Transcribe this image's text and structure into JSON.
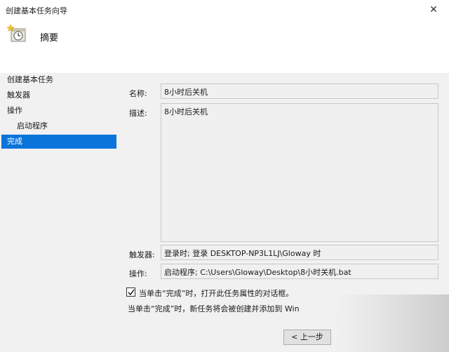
{
  "window": {
    "title": "创建基本任务向导",
    "close_glyph": "✕"
  },
  "header": {
    "heading": "摘要",
    "icon": "task-clock-icon"
  },
  "sidebar": {
    "items": [
      {
        "label": "创建基本任务"
      },
      {
        "label": "触发器"
      },
      {
        "label": "操作"
      },
      {
        "label": "启动程序"
      },
      {
        "label": "完成"
      }
    ]
  },
  "summary": {
    "name_label": "名称:",
    "name_value": "8小时后关机",
    "desc_label": "描述:",
    "desc_value": "8小时后关机",
    "trigger_label": "触发器:",
    "trigger_value": "登录时; 登录 DESKTOP-NP3L1LJ\\Gloway 时",
    "action_label": "操作:",
    "action_value": "启动程序; C:\\Users\\Gloway\\Desktop\\8小时关机.bat"
  },
  "options": {
    "open_properties_label": "当单击“完成”时，打开此任务属性的对话框。",
    "open_properties_checked": true,
    "note": "当单击“完成”时，新任务将会被创建并添加到 Win"
  },
  "buttons": {
    "back_label": "< 上一步"
  },
  "colors": {
    "accent": "#0a74da",
    "panel": "#f1f1f1"
  }
}
